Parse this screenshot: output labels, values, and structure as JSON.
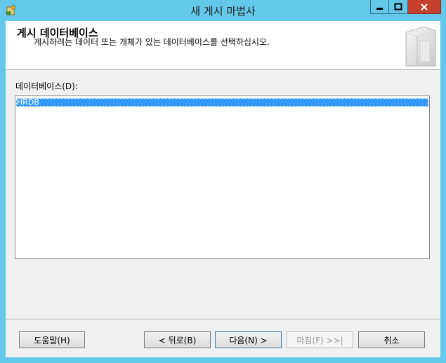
{
  "window": {
    "title": "새 게시 마법사",
    "minimize_label": "▬",
    "maximize_label": "□",
    "close_label": "x",
    "colors": {
      "titlebar": "#64c8ea",
      "close": "#c7402f"
    }
  },
  "header": {
    "title": "게시 데이터베이스",
    "description": "게시하려는 데이터 또는 개체가 있는 데이터베이스를 선택하십시오."
  },
  "main": {
    "databases_label": "데이터베이스(D):",
    "databases": [
      "HRDB"
    ],
    "selected": "HRDB"
  },
  "footer": {
    "help_label": "도움말(H)",
    "back_label": "< 뒤로(B)",
    "next_label": "다음(N) >",
    "finish_label": "마침(F) >>|",
    "cancel_label": "취소"
  }
}
